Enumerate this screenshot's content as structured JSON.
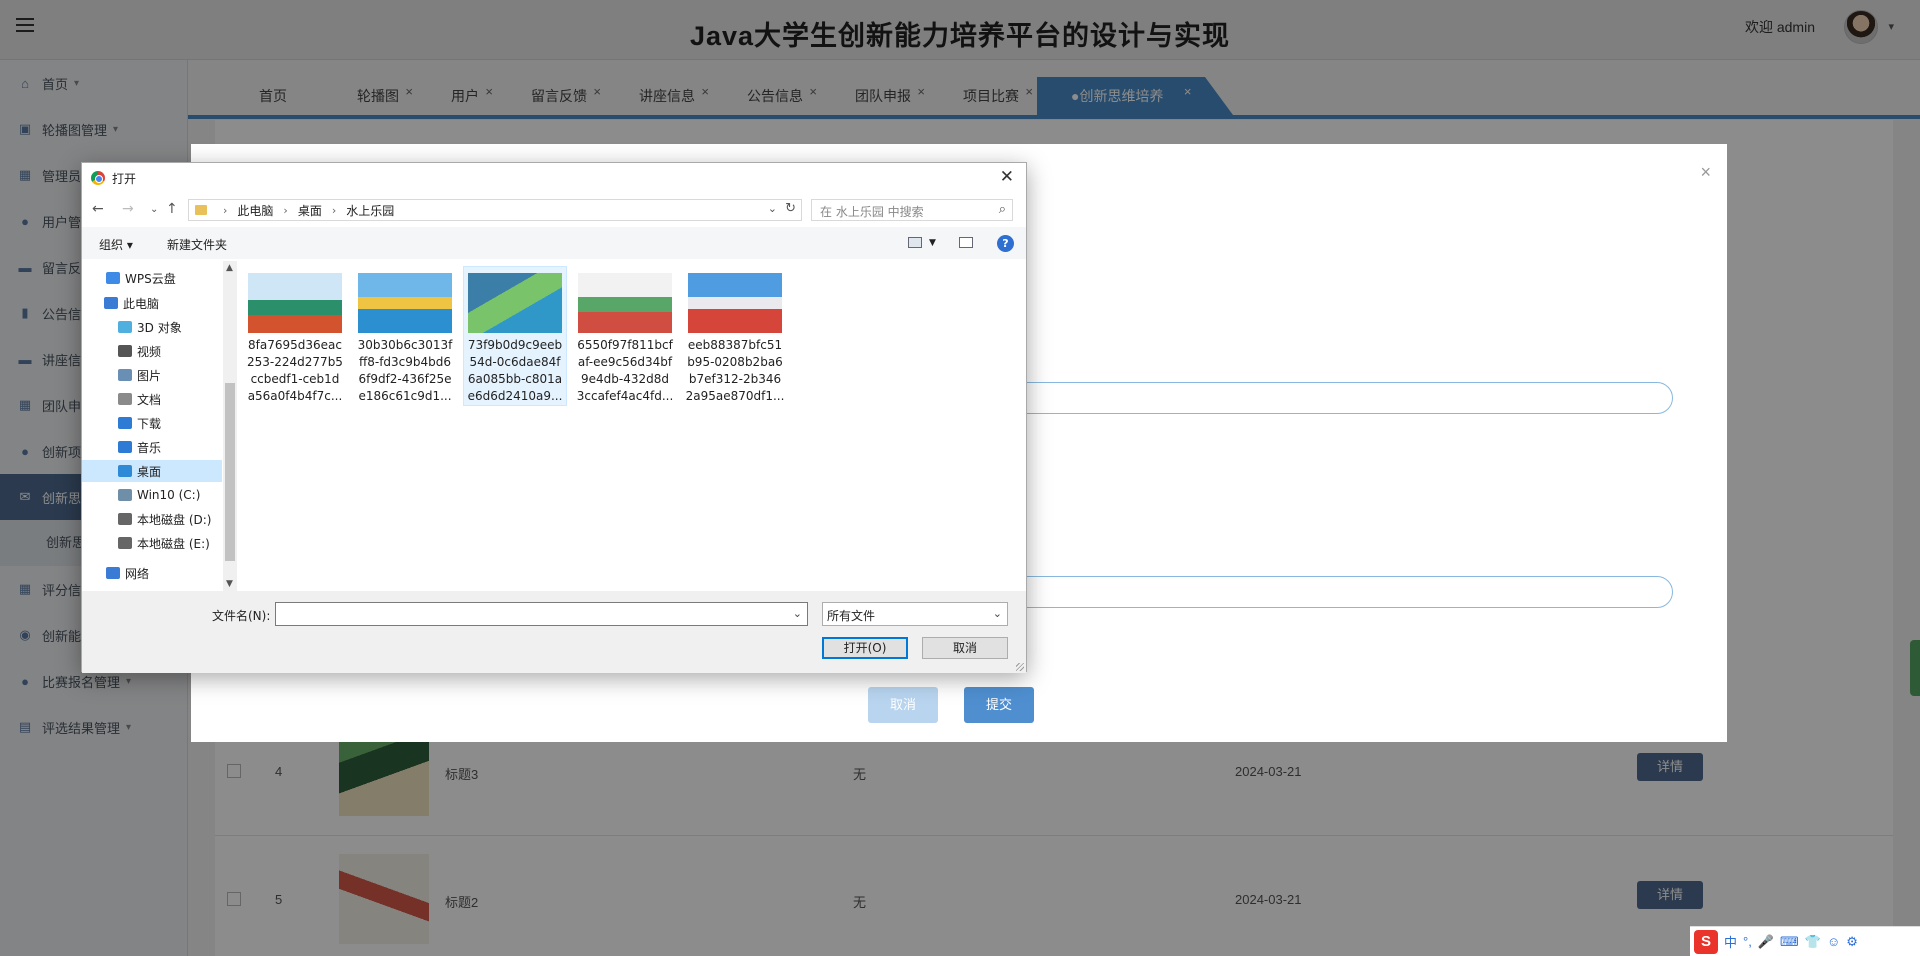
{
  "topbar": {
    "title": "Java大学生创新能力培养平台的设计与实现",
    "welcome": "欢迎 admin"
  },
  "sidebar": {
    "items": [
      {
        "label": "首页",
        "icon": "home-icon"
      },
      {
        "label": "轮播图管理",
        "icon": "image-icon"
      },
      {
        "label": "管理员",
        "icon": "grid-icon"
      },
      {
        "label": "用户管",
        "icon": "user-icon"
      },
      {
        "label": "留言反",
        "icon": "message-icon"
      },
      {
        "label": "公告信",
        "icon": "notice-icon"
      },
      {
        "label": "讲座信",
        "icon": "lecture-icon"
      },
      {
        "label": "团队申",
        "icon": "team-icon"
      },
      {
        "label": "创新项",
        "icon": "project-icon"
      },
      {
        "label": "创新思",
        "icon": "envelope-icon"
      },
      {
        "label": "创新思",
        "icon": "submenu"
      },
      {
        "label": "评分信",
        "icon": "score-icon"
      },
      {
        "label": "创新能",
        "icon": "ability-icon"
      },
      {
        "label": "比赛报名管理",
        "icon": "drop-icon"
      },
      {
        "label": "评选结果管理",
        "icon": "result-icon"
      }
    ]
  },
  "tabs": [
    {
      "label": "首页",
      "closable": false
    },
    {
      "label": "轮播图",
      "closable": true
    },
    {
      "label": "用户",
      "closable": true
    },
    {
      "label": "留言反馈",
      "closable": true
    },
    {
      "label": "讲座信息",
      "closable": true
    },
    {
      "label": "公告信息",
      "closable": true
    },
    {
      "label": "团队申报",
      "closable": true
    },
    {
      "label": "项目比赛",
      "closable": true
    },
    {
      "label": "●创新思维培养",
      "closable": true,
      "active": true
    }
  ],
  "table": {
    "rows": [
      {
        "num": "4",
        "title": "标题3",
        "remark": "无",
        "date": "2024-03-21",
        "action": "详情"
      },
      {
        "num": "5",
        "title": "标题2",
        "remark": "无",
        "date": "2024-03-21",
        "action": "详情"
      }
    ]
  },
  "modal": {
    "cancel": "取消",
    "submit": "提交"
  },
  "dialog": {
    "title": "打开",
    "path": [
      "此电脑",
      "桌面",
      "水上乐园"
    ],
    "search_placeholder": "在 水上乐园 中搜索",
    "organize": "组织",
    "new_folder": "新建文件夹",
    "tree": [
      {
        "label": "WPS云盘",
        "color": "#3d8be6"
      },
      {
        "label": "此电脑",
        "color": "#3a7bd5"
      },
      {
        "label": "3D 对象",
        "color": "#4fb0e0"
      },
      {
        "label": "视频",
        "color": "#555555"
      },
      {
        "label": "图片",
        "color": "#6a8fb5"
      },
      {
        "label": "文档",
        "color": "#8a8a8a"
      },
      {
        "label": "下载",
        "color": "#2e7bd6"
      },
      {
        "label": "音乐",
        "color": "#2e7bd6"
      },
      {
        "label": "桌面",
        "color": "#2e8ad6"
      },
      {
        "label": "Win10 (C:)",
        "color": "#6f8fa8"
      },
      {
        "label": "本地磁盘 (D:)",
        "color": "#666666"
      },
      {
        "label": "本地磁盘 (E:)",
        "color": "#666666"
      },
      {
        "label": "网络",
        "color": "#3a7bd5"
      }
    ],
    "files": [
      {
        "name": "8fa7695d36eac253-224d277b5ccbedf1-ceb1da56a0f4b4f7c...",
        "lines": [
          "8fa7695d36eac",
          "253-224d277b5",
          "ccbedf1-ceb1d",
          "a56a0f4b4f7c..."
        ]
      },
      {
        "name": "30b30b6c3013fff8-fd3c9b4bd66f9df2-436f25ee186c61c9d1...",
        "lines": [
          "30b30b6c3013f",
          "ff8-fd3c9b4bd6",
          "6f9df2-436f25e",
          "e186c61c9d1..."
        ]
      },
      {
        "name": "73f9b0d9c9eeb54d-0c6dae84f6a085bb-c801ae6d6d2410a9...",
        "lines": [
          "73f9b0d9c9eeb",
          "54d-0c6dae84f",
          "6a085bb-c801a",
          "e6d6d2410a9..."
        ]
      },
      {
        "name": "6550f97f811bcfaf-ee9c56d34bf9e4db-432d8d3ccafef4ac4fd...",
        "lines": [
          "6550f97f811bcf",
          "af-ee9c56d34bf",
          "9e4db-432d8d",
          "3ccafef4ac4fd..."
        ]
      },
      {
        "name": "eeb88387bfc51b95-0208b2ba6b7ef312-2b3462a95ae870df1...",
        "lines": [
          "eeb88387bfc51",
          "b95-0208b2ba6",
          "b7ef312-2b346",
          "2a95ae870df1..."
        ]
      }
    ],
    "filename_label": "文件名(N):",
    "filename_value": "",
    "filetype": "所有文件",
    "open": "打开(O)",
    "cancel": "取消"
  },
  "ime": {
    "logo": "S",
    "mode": "中"
  }
}
